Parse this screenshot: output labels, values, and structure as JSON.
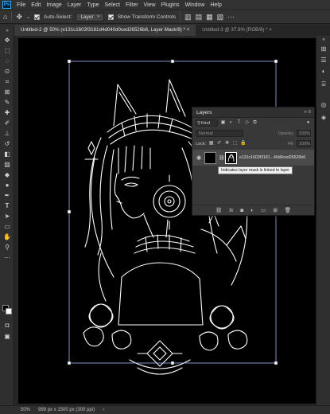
{
  "app": {
    "logo": "Ps",
    "menu": [
      "File",
      "Edit",
      "Image",
      "Layer",
      "Type",
      "Select",
      "Filter",
      "View",
      "Plugins",
      "Window",
      "Help"
    ]
  },
  "options_bar": {
    "auto_select_label": "Auto-Select:",
    "auto_select_value": "Layer",
    "show_transform_label": "Show Transform Controls"
  },
  "tabs": [
    {
      "label": "Untitled-2 @ 50% (e131c1603f3181d4d040d0ced26526b6, Layer Mask/8) *",
      "close": "×"
    },
    {
      "label": "Untitled-3 @ 37.9% (RGB/8) *",
      "close": "×"
    }
  ],
  "layers_panel": {
    "title": "Layers",
    "header_ctrls": "«  ≡",
    "filter_kind": "Kind",
    "blend_mode": "Normal",
    "opacity_label": "Opacity:",
    "opacity_value": "100%",
    "lock_label": "Lock:",
    "fill_label": "Fill:",
    "fill_value": "100%",
    "layer_name": "e131c1603f3181...40d0ced26526b6",
    "tooltip": "Indicates layer mask is linked to layer"
  },
  "status": {
    "zoom": "50%",
    "doc_info": "999 px x 1500 px (300 ppi)"
  }
}
